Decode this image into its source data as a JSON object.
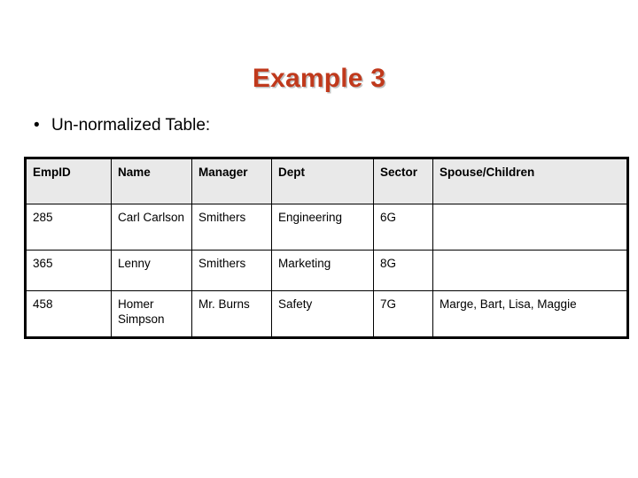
{
  "slide": {
    "title": "Example 3",
    "bullet_marker": "•",
    "bullet_text": "Un-normalized Table:",
    "title_color": "#c0391c",
    "header_fill": "#e9e9e9",
    "border_color": "#000000"
  },
  "table": {
    "columns": [
      "EmpID",
      "Name",
      "Manager",
      "Dept",
      "Sector",
      "Spouse/Children"
    ],
    "rows": [
      {
        "empid": "285",
        "name": "Carl Carlson",
        "manager": "Smithers",
        "dept": "Engineering",
        "sector": "6G",
        "spouse_children": ""
      },
      {
        "empid": "365",
        "name": "Lenny",
        "manager": "Smithers",
        "dept": "Marketing",
        "sector": "8G",
        "spouse_children": ""
      },
      {
        "empid": "458",
        "name": "Homer Simpson",
        "manager": "Mr. Burns",
        "dept": "Safety",
        "sector": "7G",
        "spouse_children": "Marge, Bart, Lisa, Maggie"
      }
    ]
  }
}
